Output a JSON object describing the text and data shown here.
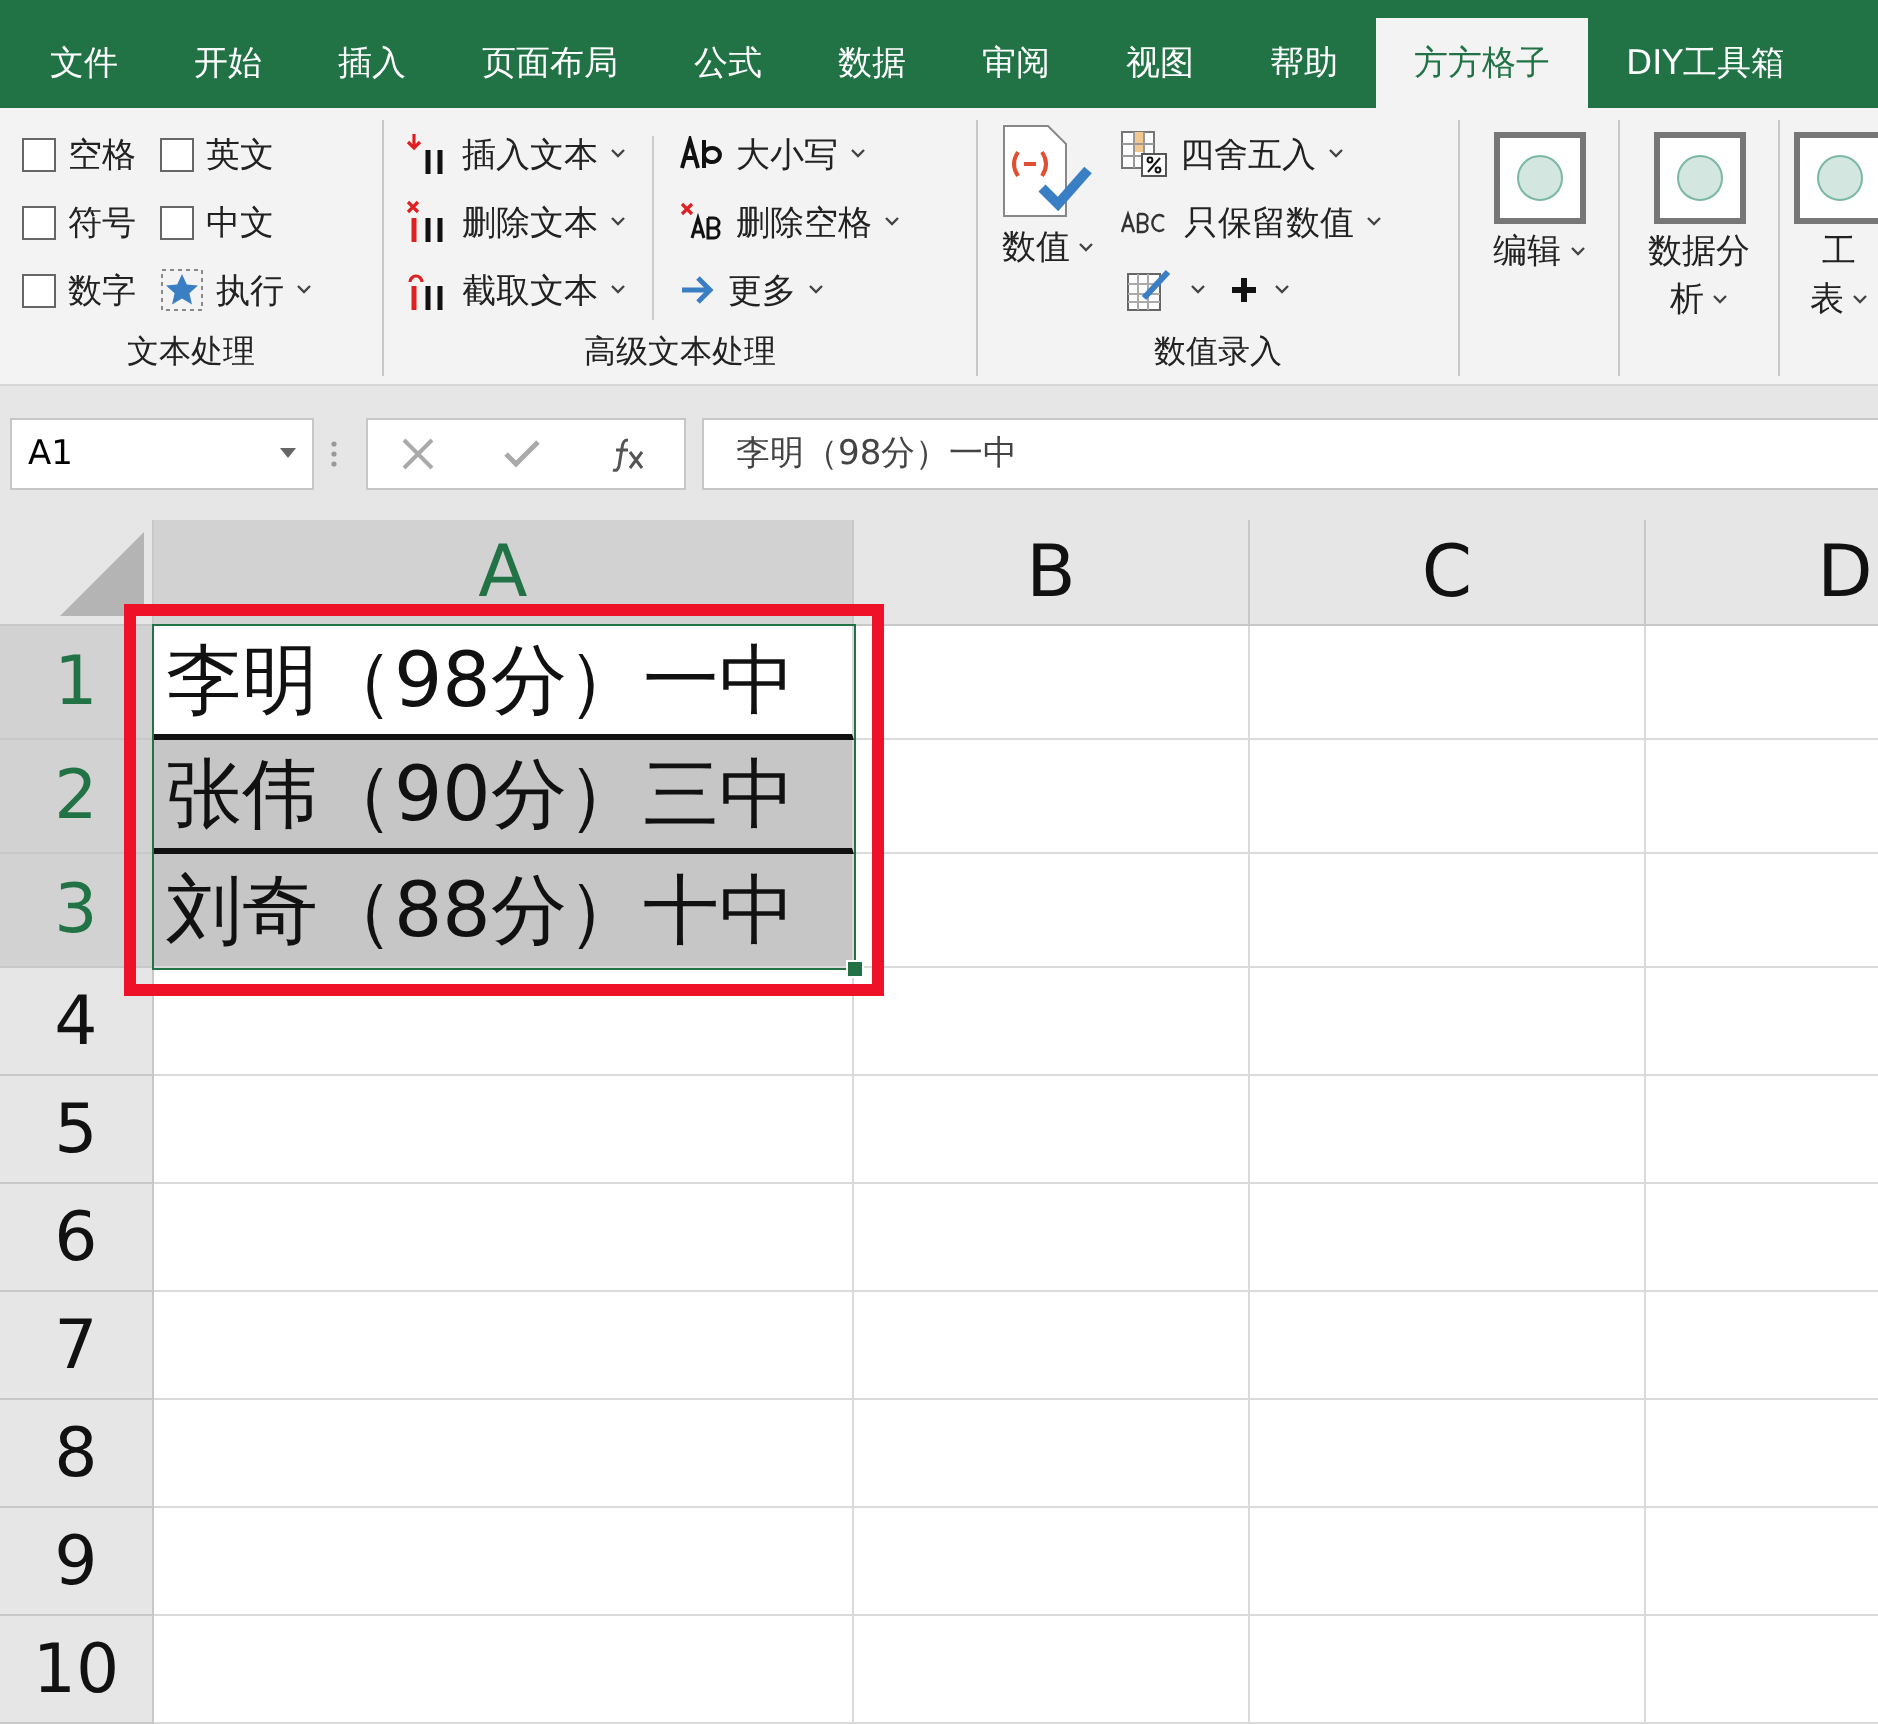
{
  "tabs": [
    {
      "label": "文件",
      "selected": false
    },
    {
      "label": "开始",
      "selected": false
    },
    {
      "label": "插入",
      "selected": false
    },
    {
      "label": "页面布局",
      "selected": false
    },
    {
      "label": "公式",
      "selected": false
    },
    {
      "label": "数据",
      "selected": false
    },
    {
      "label": "审阅",
      "selected": false
    },
    {
      "label": "视图",
      "selected": false
    },
    {
      "label": "帮助",
      "selected": false
    },
    {
      "label": "方方格子",
      "selected": true
    },
    {
      "label": "DIY工具箱",
      "selected": false
    }
  ],
  "ribbon": {
    "groups": [
      {
        "label": "文本处理",
        "items": [
          {
            "kind": "checkbox",
            "label": "空格",
            "checked": false
          },
          {
            "kind": "checkbox",
            "label": "符号",
            "checked": false
          },
          {
            "kind": "checkbox",
            "label": "数字",
            "checked": false
          },
          {
            "kind": "checkbox",
            "label": "英文",
            "checked": false
          },
          {
            "kind": "checkbox",
            "label": "中文",
            "checked": false
          },
          {
            "kind": "menu",
            "label": "执行"
          }
        ]
      },
      {
        "label": "高级文本处理",
        "items": [
          {
            "kind": "menu",
            "label": "插入文本"
          },
          {
            "kind": "menu",
            "label": "删除文本"
          },
          {
            "kind": "menu",
            "label": "截取文本"
          },
          {
            "kind": "menu",
            "label": "大小写"
          },
          {
            "kind": "menu",
            "label": "删除空格"
          },
          {
            "kind": "menu",
            "label": "更多"
          }
        ]
      },
      {
        "label": "数值录入",
        "items": [
          {
            "kind": "large",
            "lines": [
              "数值"
            ]
          },
          {
            "kind": "menu",
            "label": "四舍五入"
          },
          {
            "kind": "menu",
            "label": "只保留数值"
          },
          {
            "kind": "iconmenu"
          },
          {
            "kind": "iconmenu"
          }
        ]
      },
      {
        "items": [
          {
            "kind": "large",
            "lines": [
              "编辑"
            ]
          }
        ]
      },
      {
        "items": [
          {
            "kind": "large",
            "lines": [
              "数据分",
              "析"
            ]
          }
        ]
      },
      {
        "items": [
          {
            "kind": "large",
            "lines": [
              "工",
              "表"
            ]
          }
        ]
      }
    ]
  },
  "name_box": "A1",
  "formula": "李明（98分）一中",
  "columns": [
    {
      "label": "A",
      "selected": true
    },
    {
      "label": "B",
      "selected": false
    },
    {
      "label": "C",
      "selected": false
    },
    {
      "label": "D",
      "selected": false
    }
  ],
  "rows": [
    {
      "header": "1",
      "selected": true,
      "cells": [
        {
          "text": "李明（98分）一中",
          "selected": false,
          "bottom_border": true
        }
      ]
    },
    {
      "header": "2",
      "selected": true,
      "cells": [
        {
          "text": "张伟（90分）三中",
          "selected": true,
          "bottom_border": true
        }
      ]
    },
    {
      "header": "3",
      "selected": true,
      "cells": [
        {
          "text": "刘奇（88分）十中",
          "selected": true,
          "bottom_border": false
        }
      ]
    },
    {
      "header": "4",
      "selected": false,
      "cells": []
    },
    {
      "header": "5",
      "selected": false,
      "cells": []
    },
    {
      "header": "6",
      "selected": false,
      "cells": []
    },
    {
      "header": "7",
      "selected": false,
      "cells": []
    },
    {
      "header": "8",
      "selected": false,
      "cells": []
    },
    {
      "header": "9",
      "selected": false,
      "cells": []
    },
    {
      "header": "10",
      "selected": false,
      "cells": []
    }
  ]
}
